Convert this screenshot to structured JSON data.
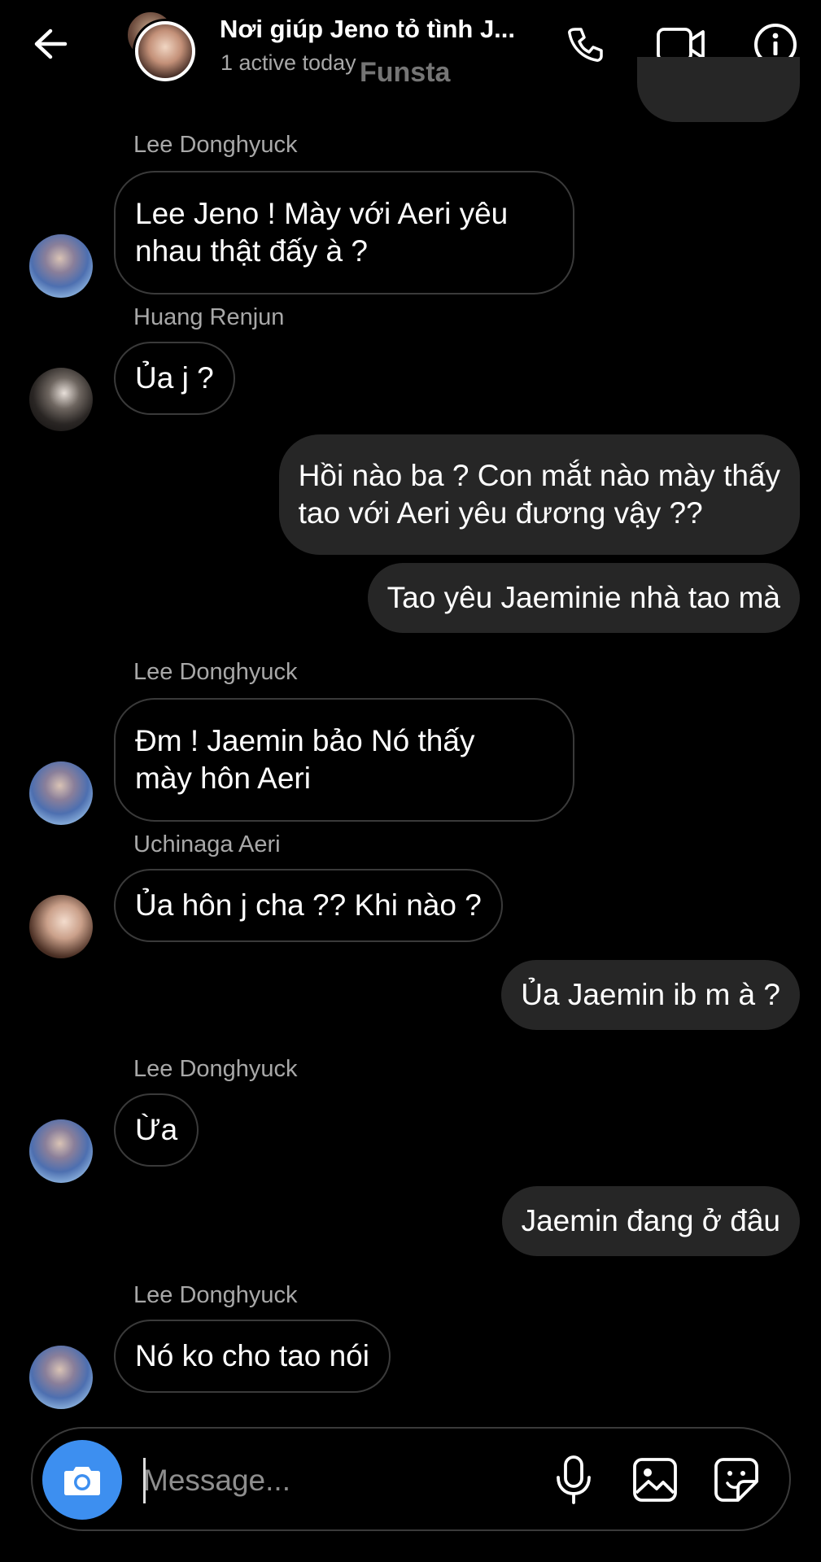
{
  "header": {
    "title": "Nơi giúp Jeno tỏ tình J...",
    "status": "1 active today",
    "watermark": "Funsta",
    "icons": [
      "back-arrow-icon",
      "phone-icon",
      "video-camera-icon",
      "info-icon"
    ]
  },
  "messages": [
    {
      "sender": "Lee Donghyuck",
      "direction": "in",
      "lines": [
        "Lee Jeno ! Mày với Aeri yêu",
        "nhau thật đấy à ?"
      ]
    },
    {
      "sender": "Huang Renjun",
      "direction": "in",
      "lines": [
        "Ủa j ?"
      ]
    },
    {
      "direction": "out",
      "lines": [
        "Hồi nào ba ? Con mắt nào mày thấy",
        "tao với Aeri yêu đương vậy ??"
      ]
    },
    {
      "direction": "out",
      "lines": [
        "Tao yêu Jaeminie nhà tao mà"
      ]
    },
    {
      "sender": "Lee Donghyuck",
      "direction": "in",
      "lines": [
        "Đm ! Jaemin bảo Nó thấy",
        "mày hôn Aeri"
      ]
    },
    {
      "sender": "Uchinaga Aeri",
      "direction": "in",
      "lines": [
        "Ủa hôn j cha ?? Khi nào ?"
      ]
    },
    {
      "direction": "out",
      "lines": [
        "Ủa Jaemin ib m à ?"
      ]
    },
    {
      "sender": "Lee Donghyuck",
      "direction": "in",
      "lines": [
        "Ừa"
      ]
    },
    {
      "direction": "out",
      "lines": [
        "Jaemin đang ở đâu"
      ]
    },
    {
      "sender": "Lee Donghyuck",
      "direction": "in",
      "lines": [
        "Nó ko cho tao nói"
      ]
    }
  ],
  "composer": {
    "placeholder": "Message...",
    "icons": [
      "camera-icon",
      "microphone-icon",
      "gallery-icon",
      "sticker-icon"
    ]
  },
  "colors": {
    "background": "#000000",
    "outgoing_bubble": "#262626",
    "incoming_border": "#3a3a3a",
    "accent_camera": "#3d8ff0",
    "secondary_text": "#a8a8a8"
  }
}
